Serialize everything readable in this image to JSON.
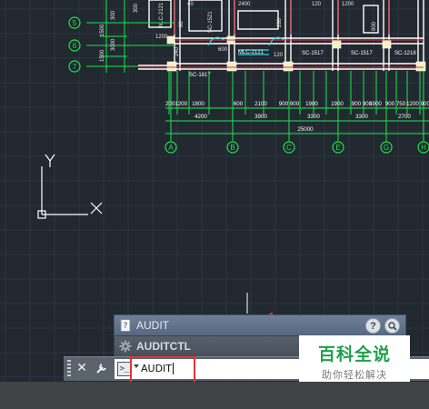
{
  "drawing": {
    "row_markers": [
      "5",
      "6",
      "7"
    ],
    "col_markers": [
      "A",
      "B",
      "C",
      "E",
      "G",
      "H"
    ],
    "dims_row1": [
      "2001200",
      "1800",
      "600",
      "2100",
      "900 900",
      "1900",
      "1900",
      "900 900",
      "1900",
      "900 750",
      "1200 900"
    ],
    "dims_row2": [
      "4200",
      "3900",
      "3300",
      "3300",
      "2700"
    ],
    "dims_total": "25000",
    "labels": [
      "SC-1817",
      "MLC-2121",
      "SC-1517",
      "SC-1517",
      "SC-1218",
      "SC-1521",
      "NLC-2121",
      "1200",
      "3000",
      "1500",
      "1500",
      "300",
      "120",
      "1200",
      "2400",
      "900",
      "600",
      "280",
      "240",
      "120",
      "60",
      "40"
    ],
    "ucs_y": "Y",
    "ucs_x": "X"
  },
  "autocomplete": {
    "item1": "AUDIT",
    "item2": "AUDITCTL",
    "help_glyph": "?"
  },
  "command_line": {
    "input_value": "AUDIT"
  },
  "watermark": {
    "title": "百科全说",
    "subtitle": "助你轻松解决"
  },
  "colors": {
    "background": "#212830",
    "dimension_green": "#17e84a",
    "wall_white": "#ffffff",
    "highlight_red": "#e03535"
  }
}
